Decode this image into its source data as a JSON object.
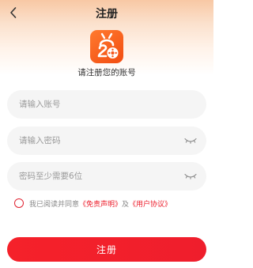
{
  "header": {
    "title": "注册",
    "back_icon": "chevron-left-icon"
  },
  "app": {
    "logo_icon": "film-cat-logo-icon",
    "brand_color": "#f5551b",
    "subtitle": "请注册您的账号"
  },
  "form": {
    "account": {
      "value": "",
      "placeholder": "请输入账号"
    },
    "password": {
      "value": "",
      "placeholder": "请输入密码",
      "toggle_icon": "eye-closed-icon"
    },
    "confirm_password": {
      "value": "",
      "placeholder": "密码至少需要6位",
      "toggle_icon": "eye-closed-icon"
    }
  },
  "agreement": {
    "checked": false,
    "text_before": "我已阅读并同意",
    "disclaimer_link": "《免责声明》",
    "text_and": "及",
    "user_agreement_link": "《用户协议》",
    "accent_color": "#ec1c2a"
  },
  "submit": {
    "label": "注册",
    "color": "#f22029"
  }
}
